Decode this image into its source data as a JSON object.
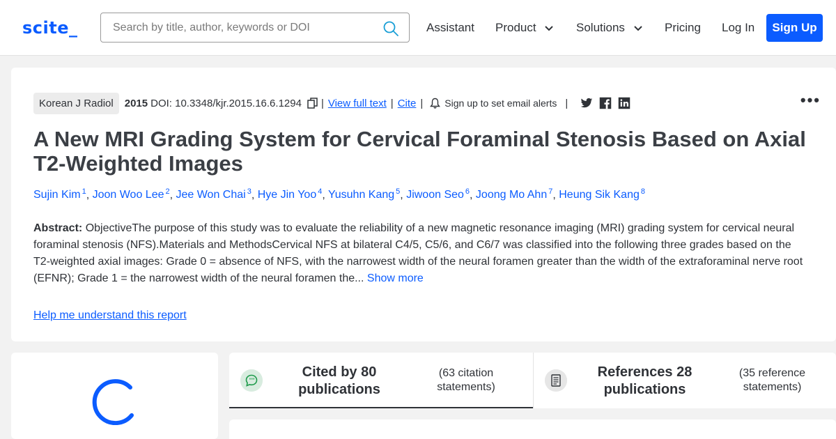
{
  "header": {
    "logo": "scite_",
    "search_placeholder": "Search by title, author, keywords or DOI",
    "nav": {
      "assistant": "Assistant",
      "product": "Product",
      "solutions": "Solutions",
      "pricing": "Pricing",
      "login": "Log In",
      "signup": "Sign Up"
    }
  },
  "paper": {
    "journal": "Korean J Radiol",
    "year": "2015",
    "doi": "DOI: 10.3348/kjr.2015.16.6.1294",
    "view_full_text": "View full text",
    "cite": "Cite",
    "alerts": "Sign up to set email alerts",
    "separator": "|",
    "more": "•••",
    "title": "A New MRI Grading System for Cervical Foraminal Stenosis Based on Axial T2-Weighted Images",
    "authors": [
      {
        "name": "Sujin Kim",
        "sup": "1"
      },
      {
        "name": "Joon Woo Lee",
        "sup": "2"
      },
      {
        "name": "Jee Won Chai",
        "sup": "3"
      },
      {
        "name": "Hye Jin Yoo",
        "sup": "4"
      },
      {
        "name": "Yusuhn Kang",
        "sup": "5"
      },
      {
        "name": "Jiwoon Seo",
        "sup": "6"
      },
      {
        "name": "Joong Mo Ahn",
        "sup": "7"
      },
      {
        "name": "Heung Sik Kang",
        "sup": "8"
      }
    ],
    "abstract_label": "Abstract:",
    "abstract_text": "ObjectiveThe purpose of this study was to evaluate the reliability of a new magnetic resonance imaging (MRI) grading system for cervical neural foraminal stenosis (NFS).Materials and MethodsCervical NFS at bilateral C4/5, C5/6, and C6/7 was classified into the following three grades based on the T2-weighted axial images: Grade 0 = absence of NFS, with the narrowest width of the neural foramen greater than the width of the extraforaminal nerve root (EFNR); Grade 1 = the narrowest width of the neural foramen the...",
    "show_more": "Show more",
    "help_link": "Help me understand this report"
  },
  "tabs": {
    "cited_main": "Cited by 80 publications",
    "cited_sub": "(63 citation statements)",
    "refs_main": "References 28 publications",
    "refs_sub": "(35 reference statements)"
  },
  "colors": {
    "brand": "#0b5cff",
    "text": "#2f3237",
    "background": "#f2f2f2",
    "tab_icon_green": "#1e9b4b"
  },
  "icons": [
    "search-icon",
    "chevron-down-icon",
    "copy-icon",
    "bell-icon",
    "twitter-icon",
    "facebook-icon",
    "linkedin-icon",
    "more-icon",
    "loading-spinner-icon",
    "speech-bubble-icon",
    "document-icon"
  ]
}
